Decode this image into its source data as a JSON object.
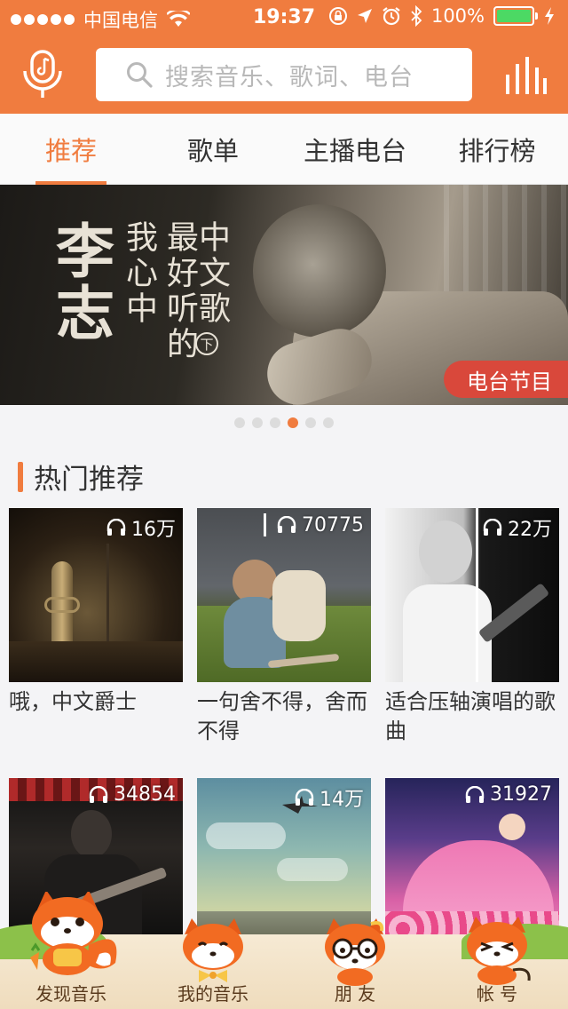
{
  "status_bar": {
    "carrier": "中国电信",
    "time": "19:37",
    "battery": "100%",
    "battery_level": 1.0
  },
  "header": {
    "search_placeholder": "搜索音乐、歌词、电台",
    "icons": [
      "microphone-note-icon",
      "search-icon",
      "equalizer-icon"
    ]
  },
  "tabs": [
    {
      "label": "推荐",
      "active": true
    },
    {
      "label": "歌单",
      "active": false
    },
    {
      "label": "主播电台",
      "active": false
    },
    {
      "label": "排行榜",
      "active": false
    }
  ],
  "banner": {
    "name": "李志",
    "line1": "我心中",
    "line2": "最好听的",
    "line3": "中文歌",
    "line3_mark": "下",
    "tag": "电台节目",
    "page_count": 6,
    "active_page": 4
  },
  "section": {
    "title": "热门推荐"
  },
  "playlists": [
    {
      "count": "16万",
      "title": "哦，中文爵士"
    },
    {
      "count": "70775",
      "title": "一句舍不得，舍而不得"
    },
    {
      "count": "22万",
      "title": "适合压轴演唱的歌曲"
    },
    {
      "count": "34854",
      "title": ""
    },
    {
      "count": "14万",
      "title": ""
    },
    {
      "count": "31927",
      "title": ""
    }
  ],
  "tabbar": [
    {
      "label": "发现音乐",
      "active": true
    },
    {
      "label": "我的音乐",
      "active": false
    },
    {
      "label": "朋 友",
      "active": false
    },
    {
      "label": "帐 号",
      "active": false
    }
  ],
  "colors": {
    "accent": "#f07c3f",
    "tag_red": "#d9483b",
    "battery_green": "#4cd964"
  }
}
